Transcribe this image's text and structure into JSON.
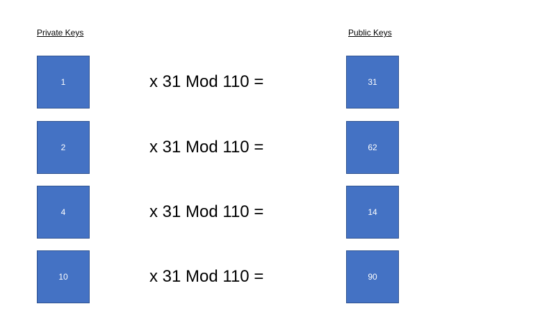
{
  "headers": {
    "private": "Private Keys",
    "public": "Public Keys"
  },
  "rows": [
    {
      "private": "1",
      "equation": "x 31 Mod 110 =",
      "public": "31"
    },
    {
      "private": "2",
      "equation": "x 31 Mod 110 =",
      "public": "62"
    },
    {
      "private": "4",
      "equation": "x 31 Mod 110 =",
      "public": "14"
    },
    {
      "private": "10",
      "equation": "x 31 Mod 110 =",
      "public": "90"
    }
  ],
  "colors": {
    "box_fill": "#4472C4",
    "box_border": "#2F528F"
  }
}
